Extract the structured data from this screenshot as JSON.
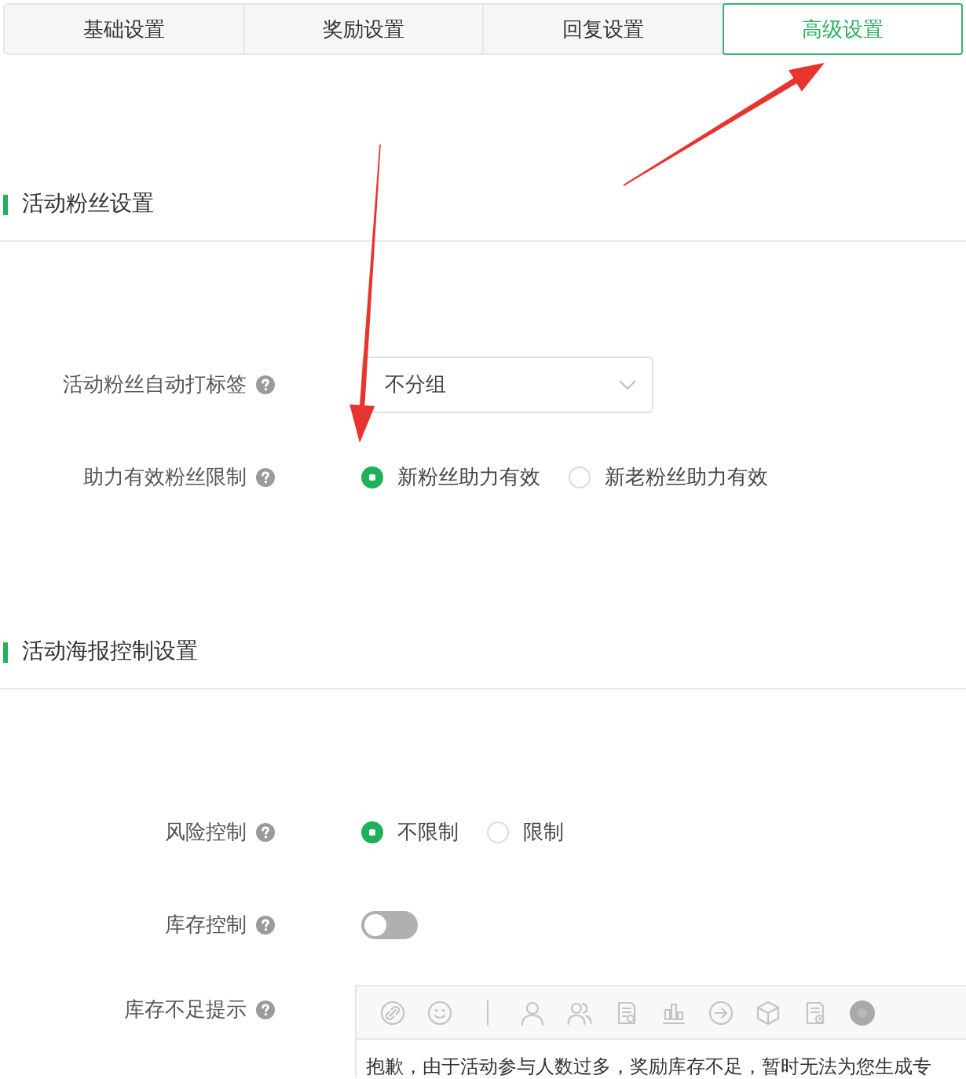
{
  "tabs": [
    {
      "label": "基础设置",
      "selected": false
    },
    {
      "label": "奖励设置",
      "selected": false
    },
    {
      "label": "回复设置",
      "selected": false
    },
    {
      "label": "高级设置",
      "selected": true
    }
  ],
  "sections": [
    {
      "title": "活动粉丝设置",
      "fields": [
        {
          "kind": "select",
          "label": "活动粉丝自动打标签",
          "value": "不分组"
        },
        {
          "kind": "radio",
          "label": "助力有效粉丝限制",
          "options": [
            {
              "label": "新粉丝助力有效",
              "selected": true
            },
            {
              "label": "新老粉丝助力有效",
              "selected": false
            }
          ]
        }
      ]
    },
    {
      "title": "活动海报控制设置",
      "fields": [
        {
          "kind": "radio",
          "label": "风险控制",
          "options": [
            {
              "label": "不限制",
              "selected": true
            },
            {
              "label": "限制",
              "selected": false
            }
          ]
        },
        {
          "kind": "switch",
          "label": "库存控制",
          "on": false
        },
        {
          "kind": "editor",
          "label": "库存不足提示",
          "value": "抱歉，由于活动参与人数过多，奖励库存不足，暂时无法为您生成专"
        }
      ]
    }
  ]
}
